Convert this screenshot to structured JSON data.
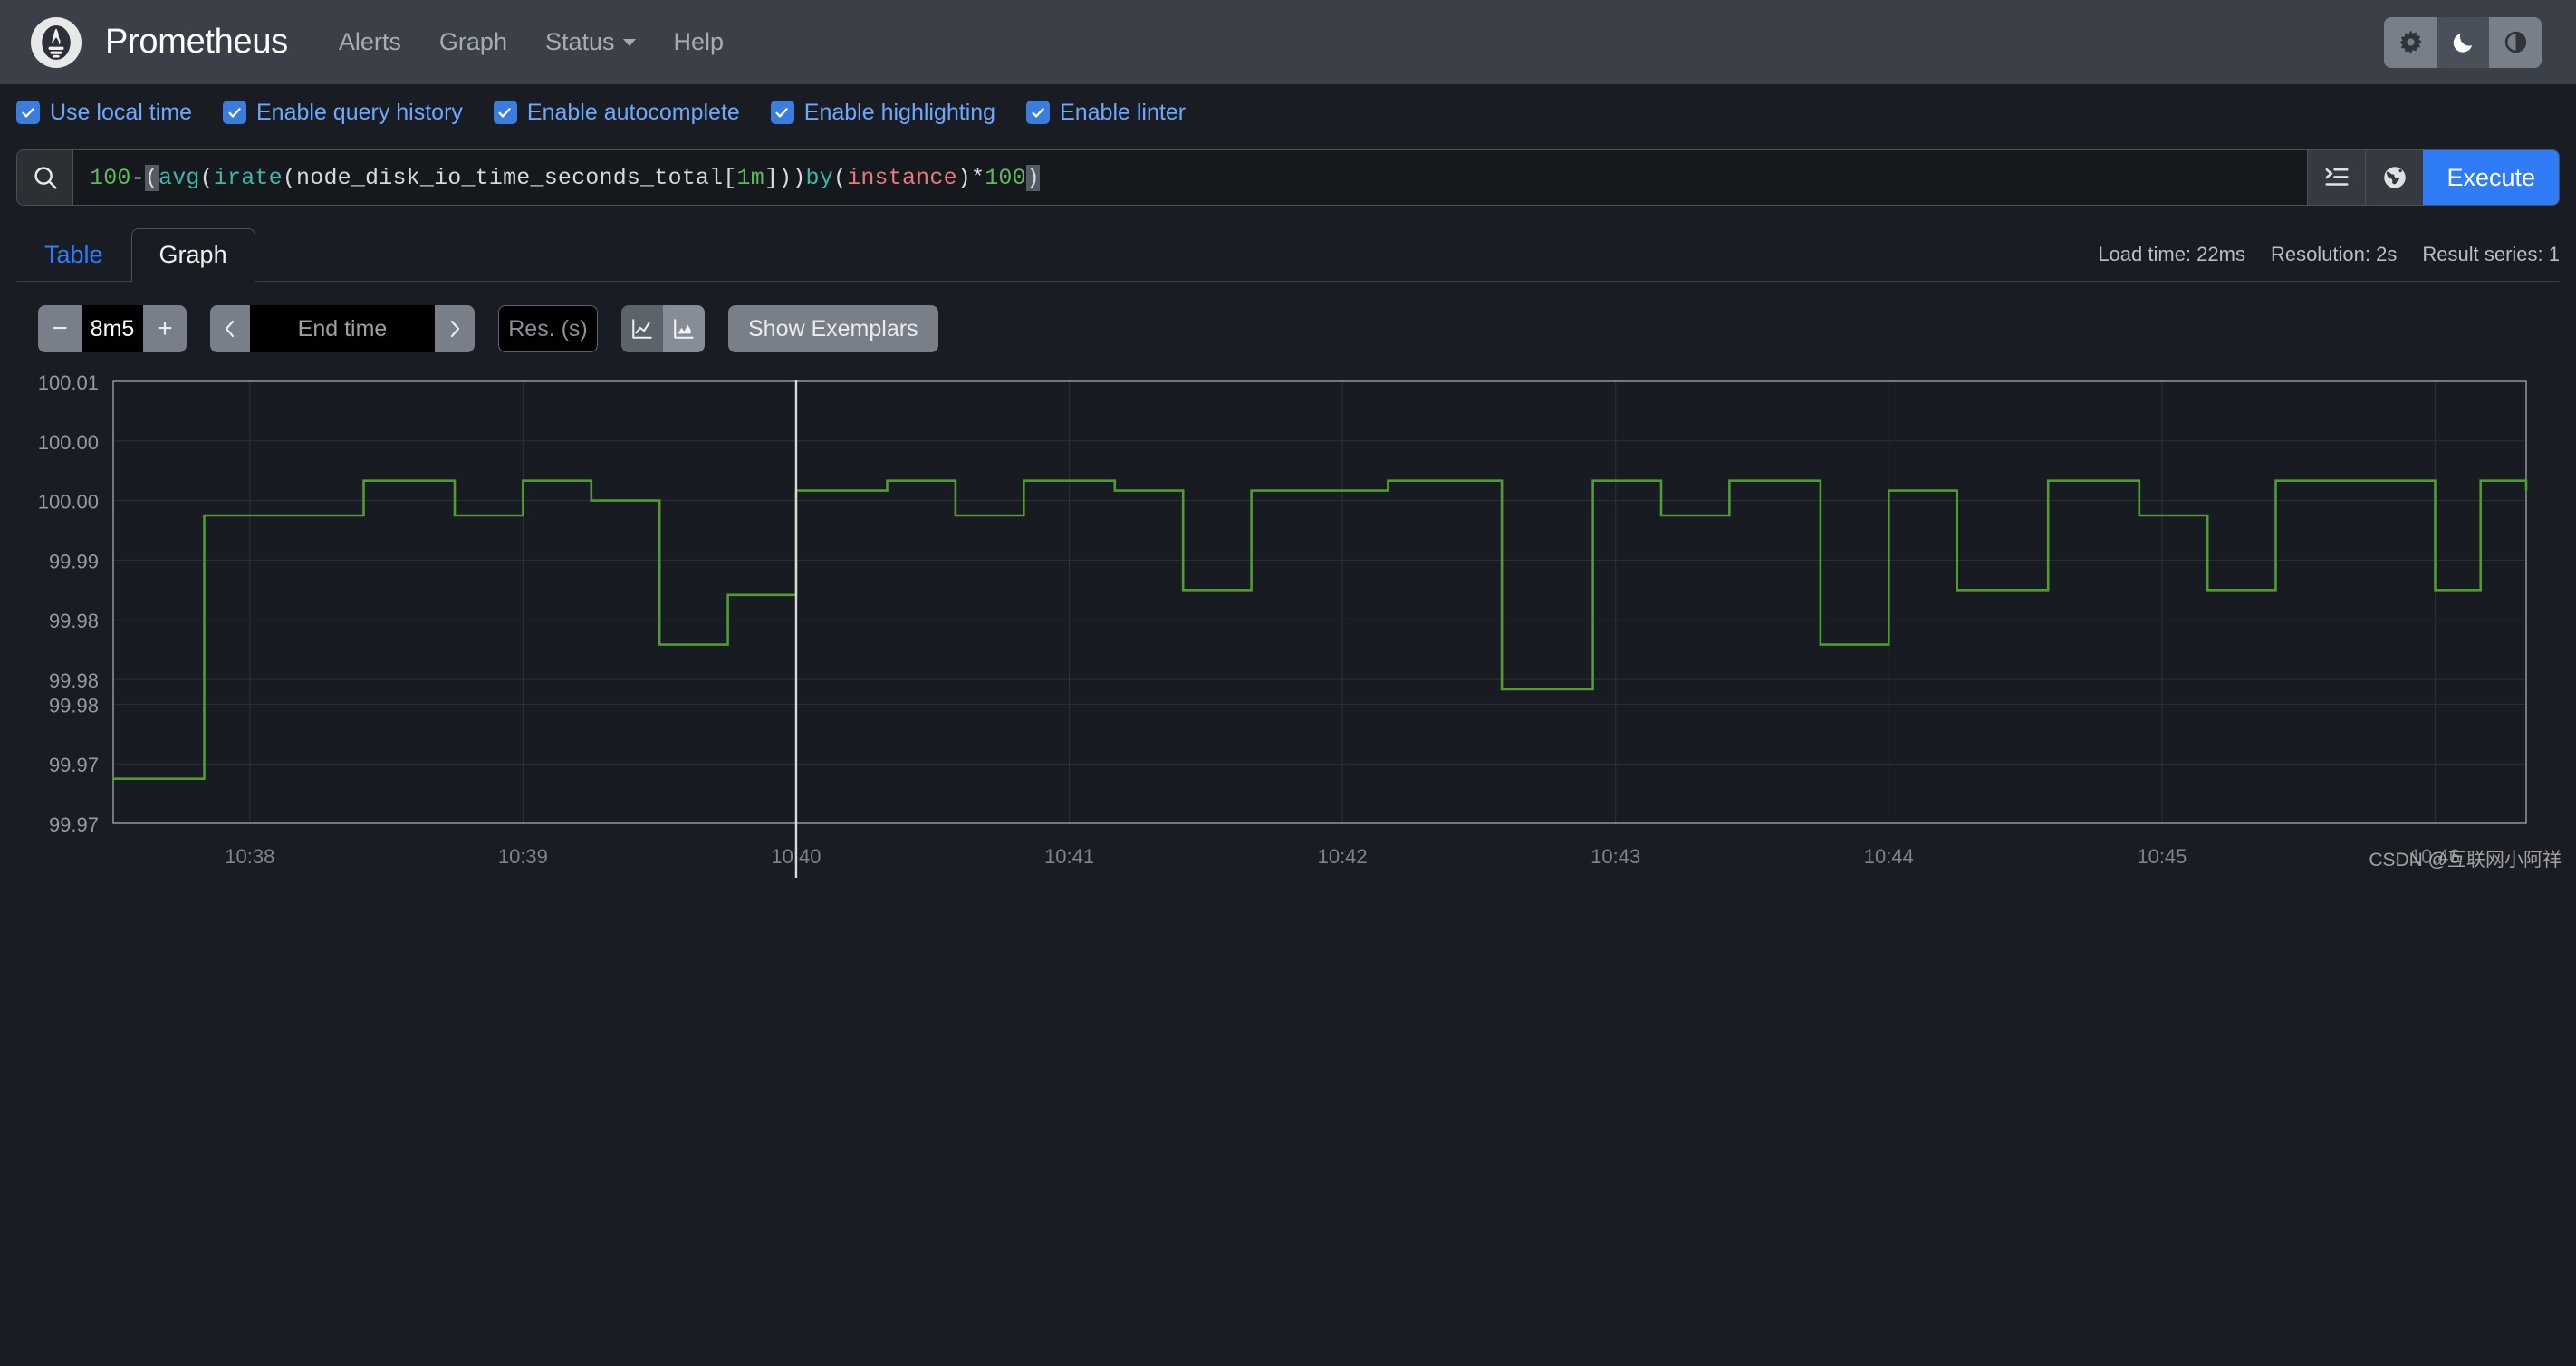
{
  "navbar": {
    "brand": "Prometheus",
    "logo_icon": "prometheus-torch-icon",
    "links": [
      {
        "label": "Alerts",
        "icon": ""
      },
      {
        "label": "Graph",
        "icon": ""
      },
      {
        "label": "Status",
        "icon": "chevron-down-icon",
        "dropdown": true
      },
      {
        "label": "Help",
        "icon": ""
      }
    ],
    "theme_buttons": [
      {
        "name": "sun-icon",
        "label": "Light theme",
        "active": false
      },
      {
        "name": "moon-icon",
        "label": "Dark theme",
        "active": true
      },
      {
        "name": "half-circle-icon",
        "label": "Auto theme",
        "active": false
      }
    ]
  },
  "options": [
    {
      "label": "Use local time",
      "checked": true
    },
    {
      "label": "Enable query history",
      "checked": true
    },
    {
      "label": "Enable autocomplete",
      "checked": true
    },
    {
      "label": "Enable highlighting",
      "checked": true
    },
    {
      "label": "Enable linter",
      "checked": true
    }
  ],
  "query": {
    "search_icon": "search-icon",
    "expression": "100-(avg(irate(node_disk_io_time_seconds_total[1m])) by(instance)* 100)",
    "tokens": [
      {
        "t": "100",
        "c": "num"
      },
      {
        "t": "-",
        "c": "plain"
      },
      {
        "t": "(",
        "c": "paren-hl"
      },
      {
        "t": "avg",
        "c": "func"
      },
      {
        "t": "(",
        "c": "plain"
      },
      {
        "t": "irate",
        "c": "func"
      },
      {
        "t": "(node_disk_io_time_seconds_total[",
        "c": "plain"
      },
      {
        "t": "1m",
        "c": "num"
      },
      {
        "t": "])) ",
        "c": "plain"
      },
      {
        "t": "by",
        "c": "func"
      },
      {
        "t": "(",
        "c": "plain"
      },
      {
        "t": "instance",
        "c": "label"
      },
      {
        "t": ")* ",
        "c": "plain"
      },
      {
        "t": "100",
        "c": "num"
      },
      {
        "t": ")",
        "c": "paren-hl"
      }
    ],
    "format_icon": "format-query-icon",
    "metrics_explorer_icon": "globe-icon",
    "execute_label": "Execute"
  },
  "tabs": [
    {
      "label": "Table",
      "active": false
    },
    {
      "label": "Graph",
      "active": true
    }
  ],
  "stats": {
    "load_time": "Load time: 22ms",
    "resolution": "Resolution: 2s",
    "result_series": "Result series: 1"
  },
  "graph_controls": {
    "range_decrease": "−",
    "range_value": "8m5",
    "range_increase": "+",
    "nav_prev_icon": "chevron-left-icon",
    "end_time_placeholder": "End time",
    "nav_next_icon": "chevron-right-icon",
    "resolution_placeholder": "Res. (s)",
    "chart_type_line_icon": "line-chart-icon",
    "chart_type_stacked_icon": "stacked-area-icon",
    "show_exemplars_label": "Show Exemplars"
  },
  "watermark": "CSDN @互联网小阿祥",
  "colors": {
    "navbar_bg": "#3b4048",
    "page_bg": "#191d23",
    "accent_blue": "#2f7cf6",
    "link_blue": "#6ea8fe",
    "series_green": "#4f9c30",
    "grid": "#2c3138",
    "crosshair": "#d8dade"
  },
  "chart_data": {
    "type": "line",
    "title": "",
    "xlabel": "",
    "ylabel": "",
    "step": true,
    "grid": true,
    "legend_position": "none",
    "x_tick_labels": [
      "10:38",
      "10:39",
      "10:40",
      "10:41",
      "10:42",
      "10:43",
      "10:44",
      "10:45",
      "10:46"
    ],
    "y_tick_labels": [
      "100.01",
      "100.00",
      "100.00",
      "99.99",
      "99.98",
      "99.98",
      "99.98",
      "99.97",
      "99.97"
    ],
    "y_tick_values": [
      100.01,
      100.004,
      99.998,
      99.992,
      99.986,
      99.98,
      99.9775,
      99.9715,
      99.9655
    ],
    "ylim": [
      99.9655,
      100.01
    ],
    "xlim": [
      "10:37:30",
      "10:46:20"
    ],
    "crosshair_x_label": "10:40",
    "series": [
      {
        "name": "instance",
        "color": "#4f9c30",
        "values": [
          {
            "t": "10:37:30",
            "v": 99.97
          },
          {
            "t": "10:37:50",
            "v": 99.9965
          },
          {
            "t": "10:38:25",
            "v": 100.0
          },
          {
            "t": "10:38:45",
            "v": 99.9965
          },
          {
            "t": "10:39:00",
            "v": 100.0
          },
          {
            "t": "10:39:15",
            "v": 99.998
          },
          {
            "t": "10:39:30",
            "v": 99.9835
          },
          {
            "t": "10:39:45",
            "v": 99.9885
          },
          {
            "t": "10:40:00",
            "v": 99.999
          },
          {
            "t": "10:40:20",
            "v": 100.0
          },
          {
            "t": "10:40:35",
            "v": 99.9965
          },
          {
            "t": "10:40:50",
            "v": 100.0
          },
          {
            "t": "10:41:10",
            "v": 99.999
          },
          {
            "t": "10:41:25",
            "v": 99.989
          },
          {
            "t": "10:41:40",
            "v": 99.999
          },
          {
            "t": "10:42:10",
            "v": 100.0
          },
          {
            "t": "10:42:35",
            "v": 99.979
          },
          {
            "t": "10:42:55",
            "v": 100.0
          },
          {
            "t": "10:43:10",
            "v": 99.9965
          },
          {
            "t": "10:43:25",
            "v": 100.0
          },
          {
            "t": "10:43:45",
            "v": 99.9835
          },
          {
            "t": "10:44:00",
            "v": 99.999
          },
          {
            "t": "10:44:15",
            "v": 99.989
          },
          {
            "t": "10:44:35",
            "v": 100.0
          },
          {
            "t": "10:44:55",
            "v": 99.9965
          },
          {
            "t": "10:45:10",
            "v": 99.989
          },
          {
            "t": "10:45:25",
            "v": 100.0
          },
          {
            "t": "10:46:00",
            "v": 99.989
          },
          {
            "t": "10:46:10",
            "v": 100.0
          },
          {
            "t": "10:46:20",
            "v": 99.999
          }
        ]
      }
    ]
  }
}
